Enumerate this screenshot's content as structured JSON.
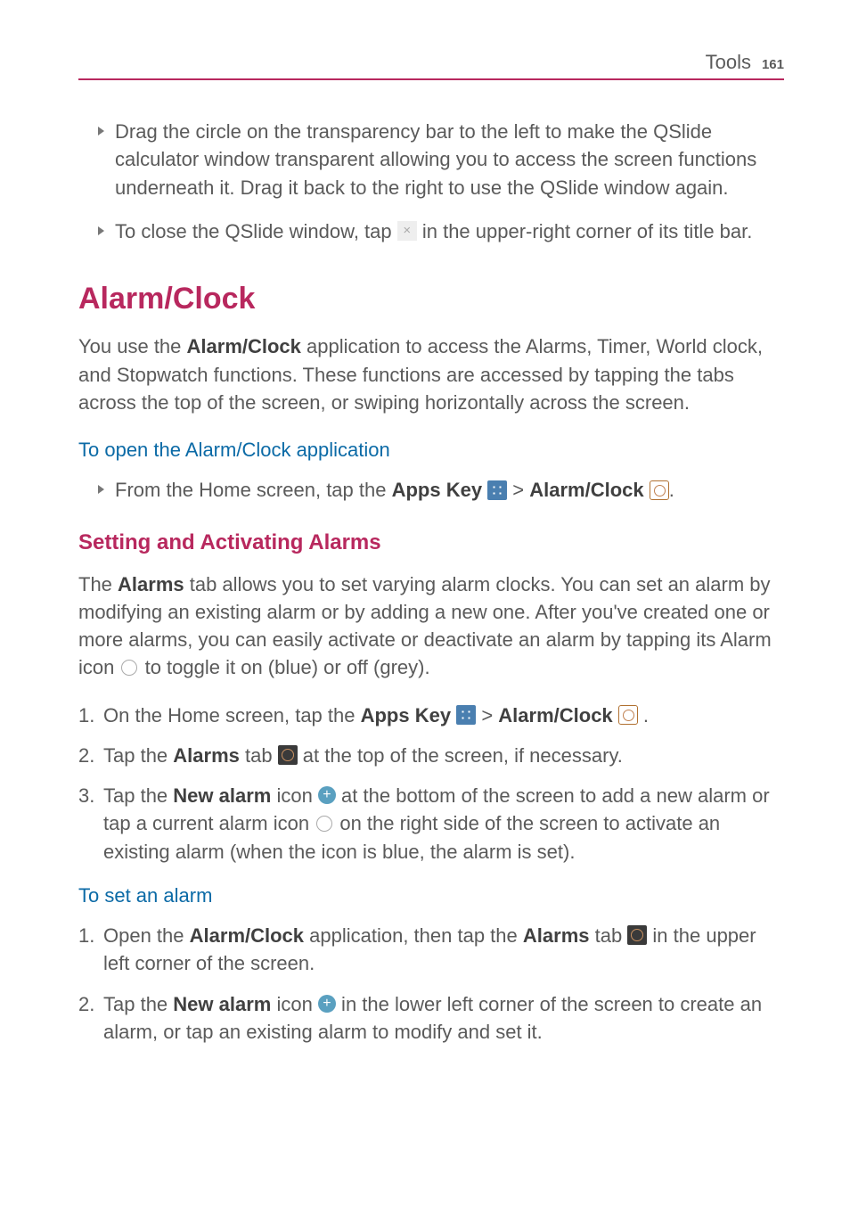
{
  "header": {
    "title": "Tools",
    "page": "161"
  },
  "bullets": {
    "b1": "Drag the circle on the transparency bar to the left to make the QSlide calculator window transparent allowing you to access the screen functions underneath it. Drag it back to the right to use the QSlide window again.",
    "b2a": "To close the QSlide window, tap ",
    "b2b": " in the upper-right corner of its title bar."
  },
  "headings": {
    "alarm_clock": "Alarm/Clock",
    "open_app": "To open the Alarm/Clock application",
    "setting": "Setting and Activating Alarms",
    "set_alarm": "To set an alarm"
  },
  "paragraphs": {
    "intro_a": "You use the ",
    "intro_bold1": "Alarm/Clock",
    "intro_b": " application to access the Alarms, Timer, World clock, and Stopwatch functions. These functions are accessed by tapping the tabs across the top of the screen, or swiping horizontally across the screen.",
    "open_a": "From the Home screen, tap the ",
    "open_bold1": "Apps Key ",
    "open_b": " > ",
    "open_bold2": "Alarm/Clock ",
    "open_c": ".",
    "setting_a": "The ",
    "setting_bold1": "Alarms",
    "setting_b": " tab allows you to set varying alarm clocks.  You can set an alarm by modifying an existing alarm or by adding a new one. After you've created one or more alarms, you can easily activate or deactivate an alarm by tapping its Alarm icon ",
    "setting_c": " to toggle it on (blue) or off (grey)."
  },
  "steps_setting": {
    "n1": "1. ",
    "s1a": "On the Home screen, tap the ",
    "s1_bold1": "Apps Key ",
    "s1b": " > ",
    "s1_bold2": "Alarm/Clock ",
    "s1c": " .",
    "n2": "2. ",
    "s2a": "Tap the ",
    "s2_bold1": "Alarms",
    "s2b": " tab ",
    "s2c": " at the top of the screen, if necessary.",
    "n3": "3. ",
    "s3a": "Tap the ",
    "s3_bold1": "New alarm",
    "s3b": " icon ",
    "s3c": " at the bottom of the screen to add a new alarm or tap a current alarm icon ",
    "s3d": " on the right side of the screen to activate an existing alarm (when the icon is blue, the alarm is set)."
  },
  "steps_set_alarm": {
    "n1": "1. ",
    "s1a": "Open the ",
    "s1_bold1": "Alarm/Clock",
    "s1b": " application, then tap the ",
    "s1_bold2": "Alarms",
    "s1c": " tab ",
    "s1d": " in the upper left corner of the screen.",
    "n2": "2. ",
    "s2a": "Tap the ",
    "s2_bold1": "New alarm",
    "s2b": " icon ",
    "s2c": " in the lower left corner of the screen to create an alarm, or tap an existing alarm to modify and set it."
  }
}
